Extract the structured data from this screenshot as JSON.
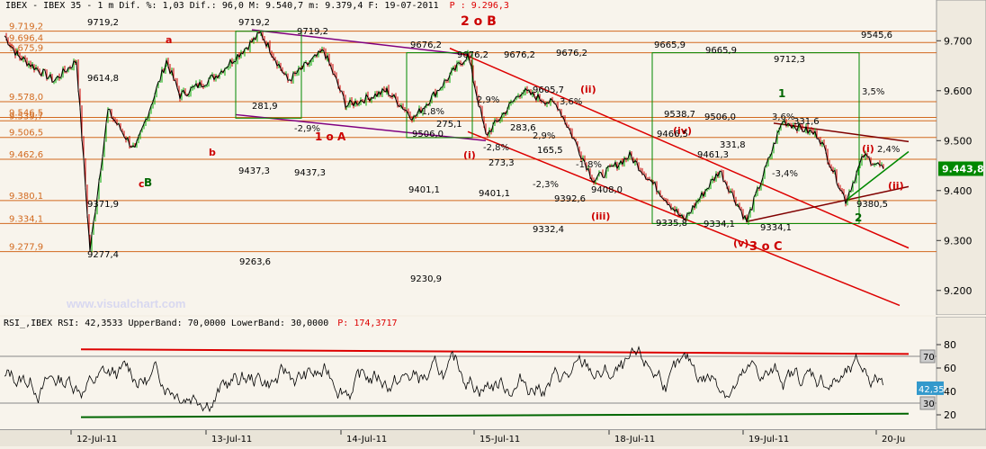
{
  "window": {
    "header": "IBEX - IBEX 35 -  1 m Dif. %: 1,03 Dif.: 96,0 M: 9.540,7 m: 9.379,4 F: 19-07-2011",
    "header_p": "P : 9.296,3",
    "buttons": [
      "–",
      "□",
      "×"
    ]
  },
  "watermark": "www.visualchart.com",
  "price_chart": {
    "type": "line",
    "y_ticks": [
      "9.700",
      "9.600",
      "9.500",
      "9.400",
      "9.300",
      "9.200"
    ],
    "ylim": [
      9160,
      9760
    ],
    "current_price": "9.443,8",
    "x_ticks": [
      "12-Jul-11",
      "13-Jul-11",
      "14-Jul-11",
      "15-Jul-11",
      "18-Jul-11",
      "19-Jul-11",
      "20-Ju"
    ],
    "left_levels": [
      "9.719,2",
      "9.696,4",
      "9.675,9",
      "9.578,0",
      "9.546,5",
      "9.539,7",
      "9.506,5",
      "9.462,6",
      "9.380,1",
      "9.334,1",
      "9.277,9"
    ],
    "wave_labels": [
      {
        "text": "2 o B",
        "color": "#cc0000"
      },
      {
        "text": "1 o A",
        "color": "#cc0000"
      },
      {
        "text": "(i)",
        "color": "#cc0000"
      },
      {
        "text": "(ii)",
        "color": "#cc0000"
      },
      {
        "text": "(iii)",
        "color": "#cc0000"
      },
      {
        "text": "(iv)",
        "color": "#cc0000"
      },
      {
        "text": "(v)",
        "color": "#cc0000"
      },
      {
        "text": "3 o C",
        "color": "#cc0000"
      },
      {
        "text": "(i)",
        "color": "#cc0000"
      },
      {
        "text": "(ii)",
        "color": "#cc0000"
      },
      {
        "text": "1",
        "color": "#006600"
      },
      {
        "text": "2",
        "color": "#006600"
      },
      {
        "text": "a",
        "color": "#cc0000"
      },
      {
        "text": "b",
        "color": "#cc0000"
      },
      {
        "text": "c",
        "color": "#cc0000"
      },
      {
        "text": "B",
        "color": "#006600"
      }
    ],
    "annotations": [
      "9719,2",
      "9719,2",
      "9719,2",
      "9676,2",
      "9676,2",
      "9676,2",
      "9614,8",
      "9605,7",
      "9676,2",
      "9665,9",
      "9665,9",
      "9712,3",
      "9545,6",
      "9538,7",
      "9506,0",
      "9506,0",
      "9466,5",
      "9461,3",
      "9437,3",
      "9437,3",
      "9401,1",
      "9401,1",
      "9408,0",
      "9392,6",
      "9371,9",
      "9335,8",
      "9334,1",
      "9334,1",
      "9332,4",
      "9380,5",
      "9263,6",
      "9230,9",
      "9277,4",
      "281,9",
      "275,1",
      "273,3",
      "283,6",
      "165,5",
      "331,8",
      "331,6",
      "-2,9%",
      "-2,8%",
      "-1,8%",
      "2,9%",
      "2,9%",
      "-2,3%",
      "-1,8%",
      "-3,4%",
      "3,6%",
      "3,5%",
      "2,4%",
      "3,6%"
    ]
  },
  "rsi_chart": {
    "type": "line",
    "header": "RSI_,IBEX RSI: 42,3533 UpperBand: 70,0000 LowerBand: 30,0000",
    "header_p": "P: 174,3717",
    "y_ticks": [
      "80",
      "60",
      "40",
      "20"
    ],
    "upper_band": "70",
    "lower_band": "30",
    "current_value": "42,35",
    "ylim": [
      10,
      90
    ]
  },
  "colors": {
    "price": "#000000",
    "up_bar": "#00aa00",
    "down_bar": "#cc0000",
    "fib": "#d2691e",
    "rsi": "#000000",
    "rsi_top": "#dd0000",
    "rsi_bottom": "#006600",
    "current_bg": "#008800"
  }
}
